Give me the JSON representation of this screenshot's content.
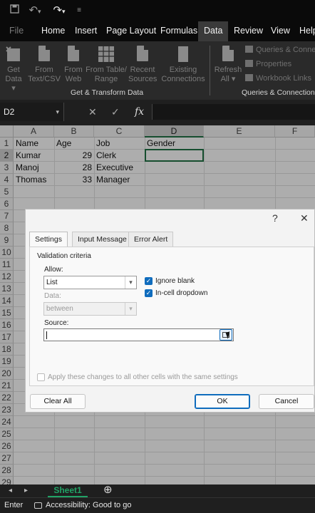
{
  "quick_access": {
    "save_icon": "save-icon",
    "undo_icon": "undo-icon",
    "redo_icon": "redo-icon",
    "customize_icon": "customize-icon"
  },
  "ribbon_tabs": [
    {
      "label": "File",
      "active": false
    },
    {
      "label": "Home",
      "active": false
    },
    {
      "label": "Insert",
      "active": false
    },
    {
      "label": "Page Layout",
      "active": false
    },
    {
      "label": "Formulas",
      "active": false
    },
    {
      "label": "Data",
      "active": true
    },
    {
      "label": "Review",
      "active": false
    },
    {
      "label": "View",
      "active": false
    },
    {
      "label": "Help",
      "active": false
    }
  ],
  "ribbon": {
    "get_data": {
      "line1": "Get",
      "line2": "Data ▾"
    },
    "from_text": {
      "line1": "From",
      "line2": "Text/CSV"
    },
    "from_web": {
      "line1": "From",
      "line2": "Web"
    },
    "from_table": {
      "line1": "From Table/",
      "line2": "Range"
    },
    "recent_sources": {
      "line1": "Recent",
      "line2": "Sources"
    },
    "existing_connections": {
      "line1": "Existing",
      "line2": "Connections"
    },
    "refresh_all": {
      "line1": "Refresh",
      "line2": "All ▾"
    },
    "queries_connections": "Queries & Connections",
    "properties": "Properties",
    "workbook_links": "Workbook Links",
    "group_get_transform": "Get & Transform Data",
    "group_queries": "Queries & Connections"
  },
  "formula_bar": {
    "name_box": "D2",
    "cancel_icon": "cancel-icon",
    "enter_icon": "check-icon",
    "fx": "fx",
    "formula": ""
  },
  "sheet": {
    "columns": [
      "A",
      "B",
      "C",
      "D",
      "E",
      "F"
    ],
    "selected_column": "D",
    "selected_row": "2",
    "row_numbers": [
      "1",
      "2",
      "3",
      "4",
      "5",
      "6",
      "7",
      "8",
      "9",
      "10",
      "11",
      "12",
      "13",
      "14",
      "15",
      "16",
      "17",
      "18",
      "19",
      "20",
      "21",
      "22",
      "23",
      "24",
      "25",
      "26",
      "27",
      "28",
      "29"
    ],
    "headers": {
      "a": "Name",
      "b": "Age",
      "c": "Job",
      "d": "Gender"
    },
    "rows": [
      {
        "name": "Kumar",
        "age": "29",
        "job": "Clerk"
      },
      {
        "name": "Manoj",
        "age": "28",
        "job": "Executive"
      },
      {
        "name": "Thomas",
        "age": "33",
        "job": "Manager"
      }
    ]
  },
  "dialog": {
    "help": "?",
    "close": "✕",
    "tabs": [
      {
        "label": "Settings",
        "active": true
      },
      {
        "label": "Input Message",
        "active": false
      },
      {
        "label": "Error Alert",
        "active": false
      }
    ],
    "criteria_title": "Validation criteria",
    "allow_label": "Allow:",
    "allow_value": "List",
    "ignore_blank_label": "Ignore blank",
    "ignore_blank_checked": true,
    "in_cell_dropdown_label": "In-cell dropdown",
    "in_cell_dropdown_checked": true,
    "data_label": "Data:",
    "data_value": "between",
    "source_label": "Source:",
    "source_value": "",
    "apply_all_label": "Apply these changes to all other cells with the same settings",
    "buttons": {
      "clear_all": "Clear All",
      "ok": "OK",
      "cancel": "Cancel"
    }
  },
  "sheet_tabs": {
    "active": "Sheet1",
    "add": "⊕",
    "prev": "◂",
    "next": "▸"
  },
  "status": {
    "mode": "Enter",
    "accessibility": "Accessibility: Good to go"
  }
}
